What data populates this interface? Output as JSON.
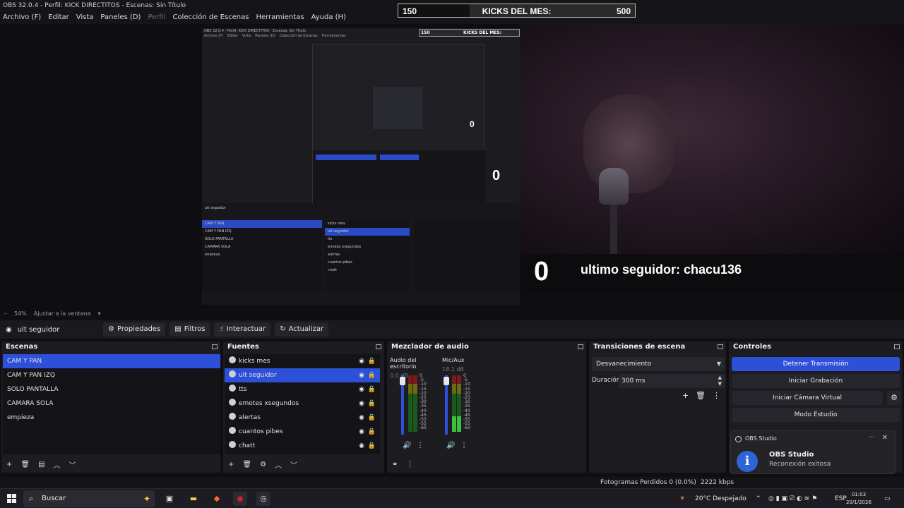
{
  "window": {
    "title": "OBS 32.0.4 - Perfil: KICK DIRECTITOS - Escenas: Sin Título"
  },
  "menu": [
    "Archivo (F)",
    "Editar",
    "Vista",
    "Paneles (D)",
    "Perfil",
    "Colección de Escenas",
    "Herramientas",
    "Ayuda (H)"
  ],
  "kicks_overlay": {
    "current": "150",
    "label": "KICKS DEL MES:",
    "goal": "500",
    "progress": 0.3
  },
  "preview": {
    "follower_count": "0",
    "follower_text": "ultimo seguidor: chacu136",
    "zoom_label": "54%",
    "fit_label": "Ajustar a la ventana"
  },
  "source_toolbar": {
    "selected_source": "ult seguidor",
    "buttons": [
      "Propiedades",
      "Filtros",
      "Interactuar",
      "Actualizar"
    ]
  },
  "scenes": {
    "title": "Escenas",
    "items": [
      "CAM Y PAN",
      "CAM Y PAN IZQ",
      "SOLO PANTALLA",
      "CAMARA SOLA",
      "empieza"
    ],
    "selected_index": 0
  },
  "sources": {
    "title": "Fuentes",
    "items": [
      "kicks mes",
      "ult seguidor",
      "tts",
      "emotes xsegundos",
      "alertas",
      "cuantos pibes",
      "chatt"
    ],
    "selected_index": 1
  },
  "mixer": {
    "title": "Mezclador de audio",
    "channels": [
      {
        "name": "Audio del escritorio",
        "db": "0.0 dB",
        "level": 0.0
      },
      {
        "name": "Mic/Aux",
        "db": "18.1 dB",
        "level": 0.28
      }
    ],
    "scale": [
      "0",
      "-5",
      "-10",
      "-15",
      "-20",
      "-25",
      "-30",
      "-35",
      "-40",
      "-45",
      "-50",
      "-55",
      "-60"
    ]
  },
  "transitions": {
    "title": "Transiciones de escena",
    "selected": "Desvanecimiento",
    "duration_label": "Duración",
    "duration_value": "300 ms"
  },
  "controls": {
    "title": "Controles",
    "buttons": [
      "Detener Transmisión",
      "Iniciar Grabación",
      "Iniciar Cámara Virtual",
      "Modo Estudio"
    ]
  },
  "toast": {
    "app": "OBS Studio",
    "title": "OBS Studio",
    "message": "Reconexión exitosa"
  },
  "status": {
    "dropped_frames": "Fotogramas Perdidos 0 (0.0%)",
    "bitrate": "2222 kbps"
  },
  "taskbar": {
    "search_placeholder": "Buscar",
    "weather": "20°C  Despejado",
    "language": "ESP",
    "time": "01:03",
    "date": "20/1/2026"
  },
  "colors": {
    "accent": "#2d50d8",
    "panel": "#1c1c21",
    "background": "#0f0f12"
  }
}
